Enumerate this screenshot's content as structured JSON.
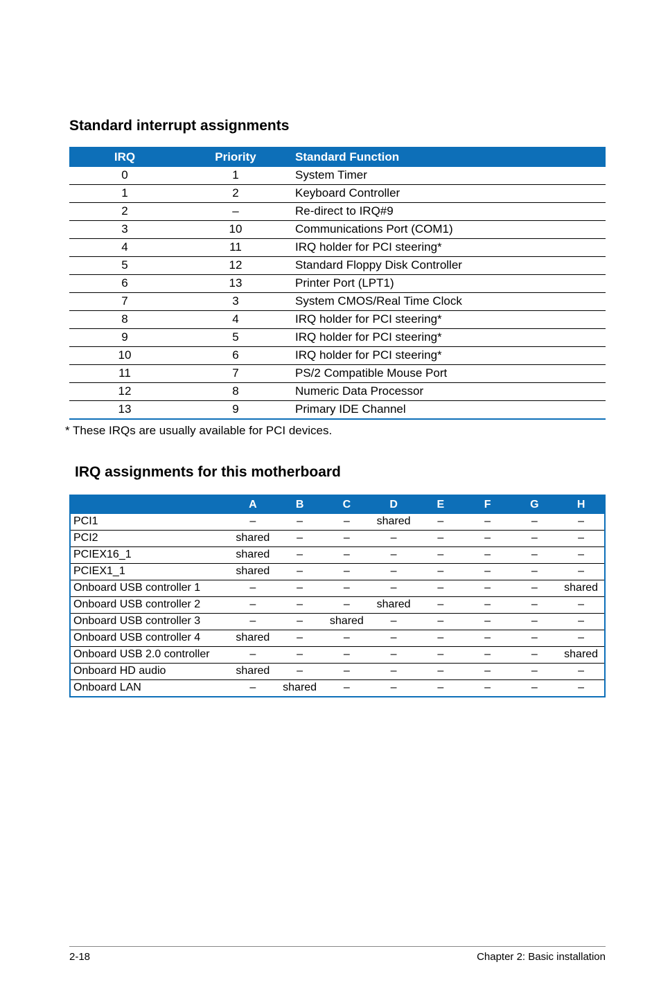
{
  "sections": {
    "s1_title": "Standard interrupt assignments",
    "s2_title": "IRQ assignments for this motherboard"
  },
  "table1": {
    "headers": {
      "irq": "IRQ",
      "priority": "Priority",
      "func": "Standard Function"
    },
    "rows": [
      {
        "irq": "0",
        "priority": "1",
        "func": "System Timer"
      },
      {
        "irq": "1",
        "priority": "2",
        "func": "Keyboard Controller"
      },
      {
        "irq": "2",
        "priority": "–",
        "func": "Re-direct to IRQ#9"
      },
      {
        "irq": "3",
        "priority": "10",
        "func": "Communications Port (COM1)"
      },
      {
        "irq": "4",
        "priority": "11",
        "func": "IRQ holder for PCI steering*"
      },
      {
        "irq": "5",
        "priority": "12",
        "func": "Standard Floppy Disk Controller"
      },
      {
        "irq": "6",
        "priority": "13",
        "func": "Printer Port (LPT1)"
      },
      {
        "irq": "7",
        "priority": "3",
        "func": "System CMOS/Real Time Clock"
      },
      {
        "irq": "8",
        "priority": "4",
        "func": "IRQ holder for PCI steering*"
      },
      {
        "irq": "9",
        "priority": "5",
        "func": "IRQ holder for PCI steering*"
      },
      {
        "irq": "10",
        "priority": "6",
        "func": "IRQ holder for PCI steering*"
      },
      {
        "irq": "11",
        "priority": "7",
        "func": "PS/2 Compatible Mouse Port"
      },
      {
        "irq": "12",
        "priority": "8",
        "func": "Numeric Data Processor"
      },
      {
        "irq": "13",
        "priority": "9",
        "func": "Primary IDE Channel"
      }
    ]
  },
  "footnote": "* These IRQs are usually available for PCI devices.",
  "table2": {
    "headers": [
      "",
      "A",
      "B",
      "C",
      "D",
      "E",
      "F",
      "G",
      "H"
    ],
    "rows": [
      {
        "dev": "PCI1",
        "cells": [
          "–",
          "–",
          "–",
          "shared",
          "–",
          "–",
          "–",
          "–"
        ]
      },
      {
        "dev": "PCI2",
        "cells": [
          "shared",
          "–",
          "–",
          "–",
          "–",
          "–",
          "–",
          "–"
        ]
      },
      {
        "dev": "PCIEX16_1",
        "cells": [
          "shared",
          "–",
          "–",
          "–",
          "–",
          "–",
          "–",
          "–"
        ]
      },
      {
        "dev": "PCIEX1_1",
        "cells": [
          "shared",
          "–",
          "–",
          "–",
          "–",
          "–",
          "–",
          "–"
        ]
      },
      {
        "dev": "Onboard USB controller 1",
        "cells": [
          "–",
          "–",
          "–",
          "–",
          "–",
          "–",
          "–",
          "shared"
        ]
      },
      {
        "dev": "Onboard USB controller 2",
        "cells": [
          "–",
          "–",
          "–",
          "shared",
          "–",
          "–",
          "–",
          "–"
        ]
      },
      {
        "dev": "Onboard USB controller 3",
        "cells": [
          "–",
          "–",
          "shared",
          "–",
          "–",
          "–",
          "–",
          "–"
        ]
      },
      {
        "dev": "Onboard USB controller 4",
        "cells": [
          "shared",
          "–",
          "–",
          "–",
          "–",
          "–",
          "–",
          "–"
        ]
      },
      {
        "dev": "Onboard USB 2.0 controller",
        "cells": [
          "–",
          "–",
          "–",
          "–",
          "–",
          "–",
          "–",
          "shared"
        ]
      },
      {
        "dev": "Onboard HD audio",
        "cells": [
          "shared",
          "–",
          "–",
          "–",
          "–",
          "–",
          "–",
          "–"
        ]
      },
      {
        "dev": "Onboard LAN",
        "cells": [
          "–",
          "shared",
          "–",
          "–",
          "–",
          "–",
          "–",
          "–"
        ]
      }
    ]
  },
  "footer": {
    "page": "2-18",
    "chapter": "Chapter 2: Basic installation"
  }
}
